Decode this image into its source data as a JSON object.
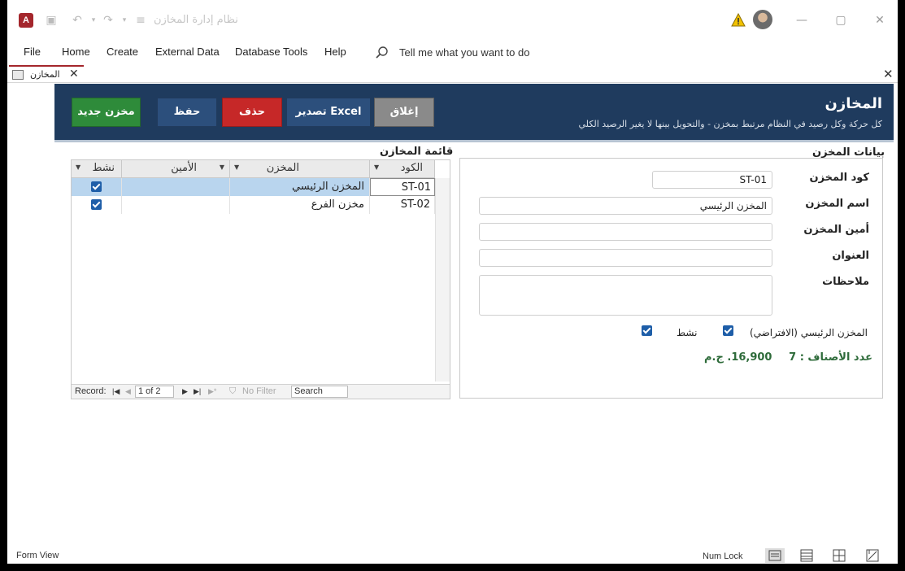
{
  "titlebar": {
    "window_title": "نظام إدارة المخازن"
  },
  "menu": [
    "File",
    "Home",
    "Create",
    "External Data",
    "Database Tools",
    "Help"
  ],
  "tell_me": "Tell me what you want to do",
  "tab": {
    "label": "المخازن"
  },
  "header": {
    "title": "المخازن",
    "subtitle": "كل حركة وكل رصيد في النظام مرتبط بمخزن - والتحويل بينها لا يغير الرصيد الكلي",
    "buttons": {
      "new": "مخزن جديد",
      "save": "حفظ",
      "delete": "حذف",
      "export": "تصدير Excel",
      "close": "إغلاق"
    },
    "colors": {
      "band": "#1f3b5e",
      "new": "#2e8b3a",
      "save": "#2c4f7c",
      "delete": "#c62828",
      "export": "#2c4f7c",
      "close": "#8a8a8a"
    }
  },
  "list": {
    "title": "قائمة المخازن",
    "columns": [
      "الكود",
      "المخزن",
      "الأمين",
      "نشط"
    ],
    "rows": [
      {
        "code": "ST-01",
        "name": "المخزن الرئيسي",
        "keeper": "",
        "active": true
      },
      {
        "code": "ST-02",
        "name": "مخزن الفرع",
        "keeper": "",
        "active": true
      }
    ],
    "nav": {
      "record_label": "Record:",
      "position": "1 of 2",
      "filter": "No Filter",
      "search": "Search"
    }
  },
  "detail": {
    "title": "بيانات المخزن",
    "labels": {
      "code": "كود المخزن",
      "name": "اسم المخزن",
      "keeper": "أمين المخزن",
      "address": "العنوان",
      "notes": "ملاحظات",
      "is_main": "المخزن الرئيسي (الافتراضي)",
      "active": "نشط"
    },
    "values": {
      "code": "ST-01",
      "name": "المخزن الرئيسي",
      "keeper": "",
      "address": "",
      "notes": ""
    },
    "is_main": true,
    "active": true,
    "items_count": "عدد الأصناف : 7",
    "value": "16,900. ج.م"
  },
  "status": {
    "view": "Form View",
    "numlock": "Num Lock"
  }
}
